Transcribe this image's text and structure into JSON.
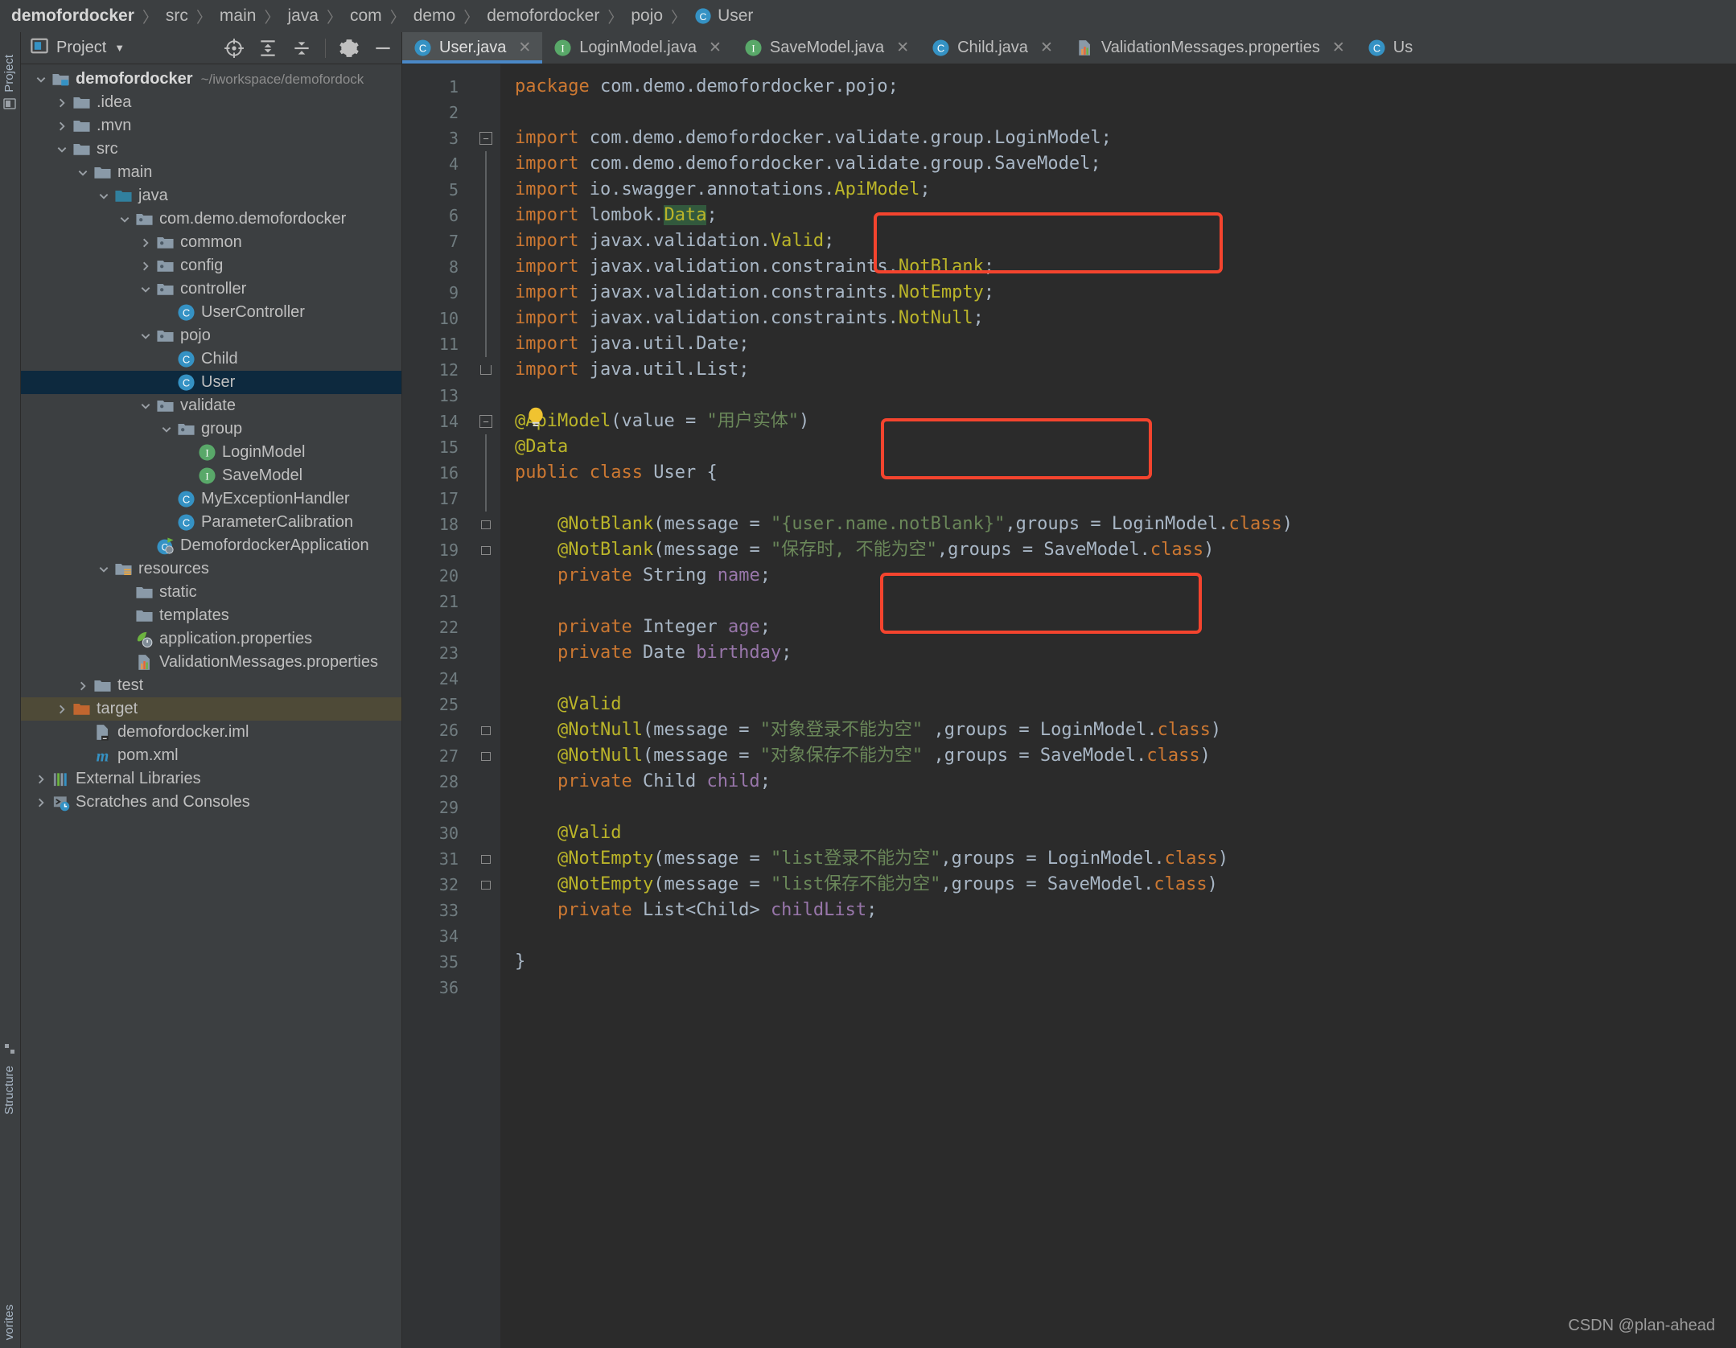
{
  "breadcrumb": {
    "items": [
      {
        "label": "demofordocker",
        "bold": true,
        "icon": null
      },
      {
        "label": "src",
        "bold": false,
        "icon": null
      },
      {
        "label": "main",
        "bold": false,
        "icon": null
      },
      {
        "label": "java",
        "bold": false,
        "icon": null
      },
      {
        "label": "com",
        "bold": false,
        "icon": null
      },
      {
        "label": "demo",
        "bold": false,
        "icon": null
      },
      {
        "label": "demofordocker",
        "bold": false,
        "icon": null
      },
      {
        "label": "pojo",
        "bold": false,
        "icon": null
      },
      {
        "label": "User",
        "bold": false,
        "icon": "class-icon"
      }
    ]
  },
  "left_strip": {
    "top_label": "Project",
    "structure_label": "Structure",
    "favorites_label": "vorites"
  },
  "project_panel": {
    "title": "Project",
    "caret": "▼",
    "tools": [
      {
        "name": "locate-icon",
        "title": "Select Opened File"
      },
      {
        "name": "expand-all-icon",
        "title": "Expand All"
      },
      {
        "name": "collapse-all-icon",
        "title": "Collapse All"
      },
      {
        "name": "gear-icon",
        "title": "Settings"
      },
      {
        "name": "hide-icon",
        "title": "Hide"
      }
    ],
    "tree": [
      {
        "label": "demofordocker",
        "path": "~/iworkspace/demofordock",
        "depth": 0,
        "arrow": "down",
        "icon": "module-folder-icon",
        "bold": true,
        "state": "none"
      },
      {
        "label": ".idea",
        "path": "",
        "depth": 1,
        "arrow": "right",
        "icon": "folder-icon",
        "bold": false,
        "state": "none"
      },
      {
        "label": ".mvn",
        "path": "",
        "depth": 1,
        "arrow": "right",
        "icon": "folder-icon",
        "bold": false,
        "state": "none"
      },
      {
        "label": "src",
        "path": "",
        "depth": 1,
        "arrow": "down",
        "icon": "folder-icon",
        "bold": false,
        "state": "none"
      },
      {
        "label": "main",
        "path": "",
        "depth": 2,
        "arrow": "down",
        "icon": "folder-icon",
        "bold": false,
        "state": "none"
      },
      {
        "label": "java",
        "path": "",
        "depth": 3,
        "arrow": "down",
        "icon": "source-folder-icon",
        "bold": false,
        "state": "none"
      },
      {
        "label": "com.demo.demofordocker",
        "path": "",
        "depth": 4,
        "arrow": "down",
        "icon": "package-icon",
        "bold": false,
        "state": "none"
      },
      {
        "label": "common",
        "path": "",
        "depth": 5,
        "arrow": "right",
        "icon": "package-icon",
        "bold": false,
        "state": "none"
      },
      {
        "label": "config",
        "path": "",
        "depth": 5,
        "arrow": "right",
        "icon": "package-icon",
        "bold": false,
        "state": "none"
      },
      {
        "label": "controller",
        "path": "",
        "depth": 5,
        "arrow": "down",
        "icon": "package-icon",
        "bold": false,
        "state": "none"
      },
      {
        "label": "UserController",
        "path": "",
        "depth": 6,
        "arrow": "none",
        "icon": "class-icon",
        "bold": false,
        "state": "none"
      },
      {
        "label": "pojo",
        "path": "",
        "depth": 5,
        "arrow": "down",
        "icon": "package-icon",
        "bold": false,
        "state": "none"
      },
      {
        "label": "Child",
        "path": "",
        "depth": 6,
        "arrow": "none",
        "icon": "class-icon",
        "bold": false,
        "state": "none"
      },
      {
        "label": "User",
        "path": "",
        "depth": 6,
        "arrow": "none",
        "icon": "class-icon",
        "bold": false,
        "state": "selected"
      },
      {
        "label": "validate",
        "path": "",
        "depth": 5,
        "arrow": "down",
        "icon": "package-icon",
        "bold": false,
        "state": "none"
      },
      {
        "label": "group",
        "path": "",
        "depth": 6,
        "arrow": "down",
        "icon": "package-icon",
        "bold": false,
        "state": "none"
      },
      {
        "label": "LoginModel",
        "path": "",
        "depth": 7,
        "arrow": "none",
        "icon": "interface-icon",
        "bold": false,
        "state": "none"
      },
      {
        "label": "SaveModel",
        "path": "",
        "depth": 7,
        "arrow": "none",
        "icon": "interface-icon",
        "bold": false,
        "state": "none"
      },
      {
        "label": "MyExceptionHandler",
        "path": "",
        "depth": 6,
        "arrow": "none",
        "icon": "class-icon",
        "bold": false,
        "state": "none"
      },
      {
        "label": "ParameterCalibration",
        "path": "",
        "depth": 6,
        "arrow": "none",
        "icon": "class-icon",
        "bold": false,
        "state": "none"
      },
      {
        "label": "DemofordockerApplication",
        "path": "",
        "depth": 5,
        "arrow": "none",
        "icon": "spring-class-icon",
        "bold": false,
        "state": "none"
      },
      {
        "label": "resources",
        "path": "",
        "depth": 3,
        "arrow": "down",
        "icon": "resources-folder-icon",
        "bold": false,
        "state": "none"
      },
      {
        "label": "static",
        "path": "",
        "depth": 4,
        "arrow": "none",
        "icon": "folder-icon",
        "bold": false,
        "state": "none"
      },
      {
        "label": "templates",
        "path": "",
        "depth": 4,
        "arrow": "none",
        "icon": "folder-icon",
        "bold": false,
        "state": "none"
      },
      {
        "label": "application.properties",
        "path": "",
        "depth": 4,
        "arrow": "none",
        "icon": "spring-properties-icon",
        "bold": false,
        "state": "none"
      },
      {
        "label": "ValidationMessages.properties",
        "path": "",
        "depth": 4,
        "arrow": "none",
        "icon": "properties-icon",
        "bold": false,
        "state": "none"
      },
      {
        "label": "test",
        "path": "",
        "depth": 2,
        "arrow": "right",
        "icon": "folder-icon",
        "bold": false,
        "state": "none"
      },
      {
        "label": "target",
        "path": "",
        "depth": 1,
        "arrow": "right",
        "icon": "excluded-folder-icon",
        "bold": false,
        "state": "highlight"
      },
      {
        "label": "demofordocker.iml",
        "path": "",
        "depth": 2,
        "arrow": "none",
        "icon": "iml-icon",
        "bold": false,
        "state": "none"
      },
      {
        "label": "pom.xml",
        "path": "",
        "depth": 2,
        "arrow": "none",
        "icon": "maven-icon",
        "bold": false,
        "state": "none"
      },
      {
        "label": "External Libraries",
        "path": "",
        "depth": 0,
        "arrow": "right",
        "icon": "libraries-icon",
        "bold": false,
        "state": "none"
      },
      {
        "label": "Scratches and Consoles",
        "path": "",
        "depth": 0,
        "arrow": "right",
        "icon": "scratches-icon",
        "bold": false,
        "state": "none"
      }
    ]
  },
  "editor": {
    "tabs": [
      {
        "label": "User.java",
        "icon": "class-icon",
        "active": true,
        "closable": true
      },
      {
        "label": "LoginModel.java",
        "icon": "interface-icon",
        "active": false,
        "closable": true
      },
      {
        "label": "SaveModel.java",
        "icon": "interface-icon",
        "active": false,
        "closable": true
      },
      {
        "label": "Child.java",
        "icon": "class-icon",
        "active": false,
        "closable": true
      },
      {
        "label": "ValidationMessages.properties",
        "icon": "properties-icon",
        "active": false,
        "closable": true
      },
      {
        "label": "Us",
        "icon": "class-icon",
        "active": false,
        "closable": false
      }
    ],
    "line_numbers": [
      1,
      2,
      3,
      4,
      5,
      6,
      7,
      8,
      9,
      10,
      11,
      12,
      13,
      14,
      15,
      16,
      17,
      18,
      19,
      20,
      21,
      22,
      23,
      24,
      25,
      26,
      27,
      28,
      29,
      30,
      31,
      32,
      33,
      34,
      35,
      36
    ],
    "lines": [
      "package com.demo.demofordocker.pojo;",
      "",
      "import com.demo.demofordocker.validate.group.LoginModel;",
      "import com.demo.demofordocker.validate.group.SaveModel;",
      "import io.swagger.annotations.ApiModel;",
      "import lombok.Data;",
      "import javax.validation.Valid;",
      "import javax.validation.constraints.NotBlank;",
      "import javax.validation.constraints.NotEmpty;",
      "import javax.validation.constraints.NotNull;",
      "import java.util.Date;",
      "import java.util.List;",
      "",
      "@ApiModel(value = \"用户实体\")",
      "@Data",
      "public class User {",
      "",
      "    @NotBlank(message = \"{user.name.notBlank}\",groups = LoginModel.class)",
      "    @NotBlank(message = \"保存时, 不能为空\",groups = SaveModel.class)",
      "    private String name;",
      "",
      "    private Integer age;",
      "    private Date birthday;",
      "",
      "    @Valid",
      "    @NotNull(message = \"对象登录不能为空\" ,groups = LoginModel.class)",
      "    @NotNull(message = \"对象保存不能为空\" ,groups = SaveModel.class)",
      "    private Child child;",
      "",
      "    @Valid",
      "    @NotEmpty(message = \"list登录不能为空\",groups = LoginModel.class)",
      "    @NotEmpty(message = \"list保存不能为空\",groups = SaveModel.class)",
      "    private List<Child> childList;",
      "",
      "}",
      ""
    ]
  },
  "watermark": "CSDN @plan-ahead",
  "colors": {
    "keyword": "#cc7832",
    "annotation": "#bbb529",
    "string": "#6a8759",
    "field": "#9876aa",
    "default_text": "#a9b7c6",
    "editor_bg": "#2b2b2b",
    "panel_bg": "#3c3f41",
    "gutter_bg": "#313335",
    "selection": "#0d293e",
    "highlight_row": "#4e4a37",
    "redbox": "#f4442e",
    "tab_active_underline": "#4a88c7",
    "class_icon": "#3592c4",
    "interface_icon": "#59a869"
  }
}
